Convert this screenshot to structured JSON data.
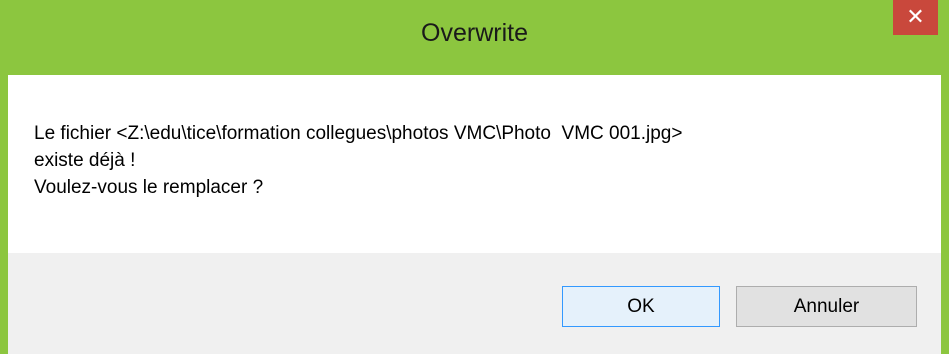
{
  "window": {
    "title": "Overwrite",
    "close_icon": "close-icon",
    "close_glyph": "✕"
  },
  "message": {
    "line1": "Le fichier <Z:\\edu\\tice\\formation collegues\\photos VMC\\Photo  VMC 001.jpg>",
    "line2": "existe déjà !",
    "line3": "Voulez-vous le remplacer ?"
  },
  "buttons": {
    "ok_label": "OK",
    "cancel_label": "Annuler"
  },
  "colors": {
    "title_bar": "#8cc63f",
    "close_button": "#c9483c",
    "focus_border": "#3399ff"
  }
}
